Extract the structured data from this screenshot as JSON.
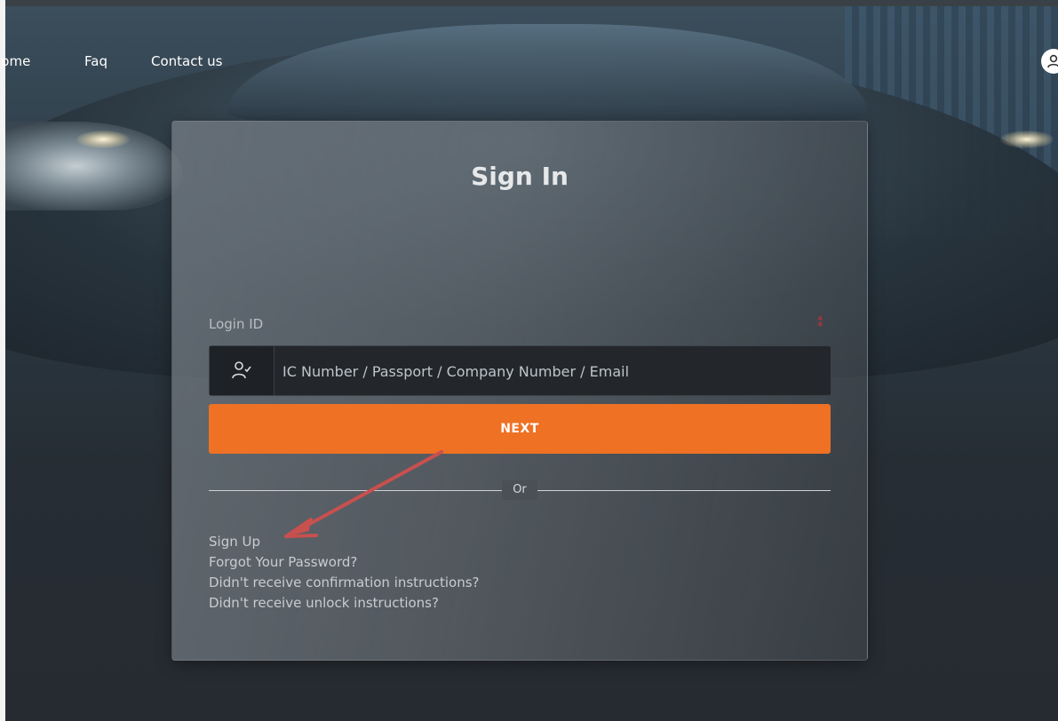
{
  "nav": {
    "home": "Home",
    "faq": "Faq",
    "contact": "Contact us"
  },
  "card": {
    "title": "Sign In",
    "login_label": "Login ID",
    "login_placeholder": "IC Number / Passport / Company Number / Email",
    "next_label": "NEXT",
    "or_label": "Or",
    "links": {
      "sign_up": "Sign Up",
      "forgot_password": "Forgot Your Password?",
      "no_confirmation": "Didn't receive confirmation instructions?",
      "no_unlock": "Didn't receive unlock instructions?"
    }
  },
  "icons": {
    "login_addon": "user-check-icon",
    "account": "account-icon",
    "required": "required-indicator"
  },
  "colors": {
    "next_button": "#ee7124",
    "annotation_arrow": "#c8504e",
    "required_mark": "#c7303a"
  }
}
